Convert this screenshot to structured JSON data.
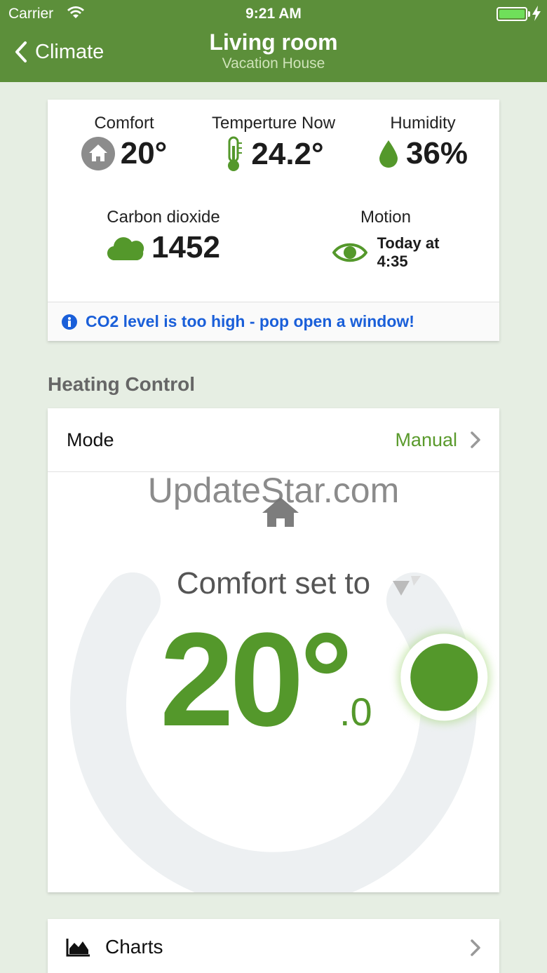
{
  "status_bar": {
    "carrier": "Carrier",
    "time": "9:21 AM",
    "battery_level": 1.0
  },
  "nav": {
    "back_label": "Climate",
    "title": "Living room",
    "subtitle": "Vacation House"
  },
  "sensors": {
    "comfort": {
      "label": "Comfort",
      "value": "20°"
    },
    "temperature": {
      "label": "Temperture Now",
      "value": "24.2°"
    },
    "humidity": {
      "label": "Humidity",
      "value": "36%"
    },
    "co2": {
      "label": "Carbon dioxide",
      "value": "1452"
    },
    "motion": {
      "label": "Motion",
      "value_line1": "Today at",
      "value_line2": "4:35"
    }
  },
  "alert": {
    "text": "CO2 level is too high - pop open a window!"
  },
  "heating": {
    "section_title": "Heating Control",
    "mode_label": "Mode",
    "mode_value": "Manual",
    "watermark": "UpdateStar.com",
    "setpoint_caption": "Comfort set to",
    "setpoint_value": "20°",
    "setpoint_decimal": ".0",
    "dial_position": 0.86
  },
  "charts": {
    "label": "Charts"
  },
  "colors": {
    "header": "#5c8f3a",
    "accent_green": "#54982b",
    "alert_blue": "#1a5fd9",
    "background": "#e6eee3"
  },
  "icons": {
    "back": "chevron-left-icon",
    "comfort": "home-circle-icon",
    "temperature": "thermometer-icon",
    "humidity": "droplet-icon",
    "co2": "cloud-icon",
    "motion": "eye-icon",
    "alert": "info-icon",
    "dial_home": "home-icon",
    "charts": "area-chart-icon"
  }
}
